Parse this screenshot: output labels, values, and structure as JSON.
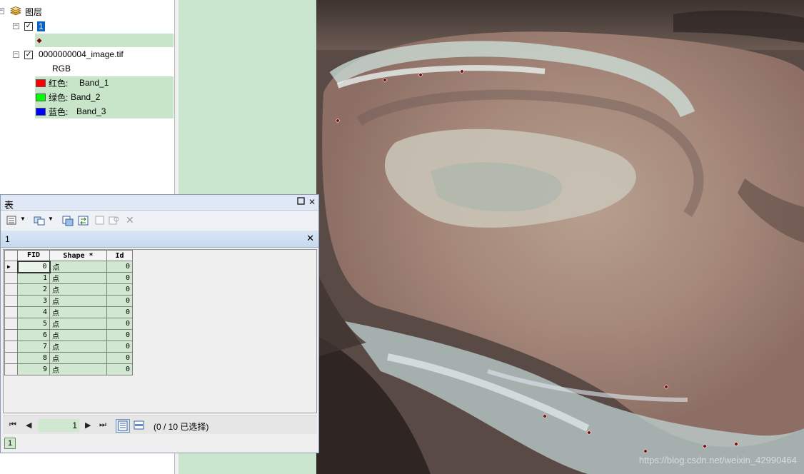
{
  "toc": {
    "root_label": "图层",
    "layer1": {
      "name": "1",
      "checked": true
    },
    "layer2": {
      "name": "0000000004_image.tif",
      "checked": true,
      "renderer": "RGB"
    },
    "bands": [
      {
        "label": "红色:",
        "band": "Band_1",
        "color": "#ff0000"
      },
      {
        "label": "绿色:",
        "band": "Band_2",
        "color": "#00ff00"
      },
      {
        "label": "蓝色:",
        "band": "Band_3",
        "color": "#0000ff"
      }
    ]
  },
  "table_window": {
    "title": "表",
    "tab_name": "1",
    "columns": [
      "FID",
      "Shape *",
      "Id"
    ],
    "rows": [
      {
        "fid": "0",
        "shape": "点",
        "id": "0"
      },
      {
        "fid": "1",
        "shape": "点",
        "id": "0"
      },
      {
        "fid": "2",
        "shape": "点",
        "id": "0"
      },
      {
        "fid": "3",
        "shape": "点",
        "id": "0"
      },
      {
        "fid": "4",
        "shape": "点",
        "id": "0"
      },
      {
        "fid": "5",
        "shape": "点",
        "id": "0"
      },
      {
        "fid": "6",
        "shape": "点",
        "id": "0"
      },
      {
        "fid": "7",
        "shape": "点",
        "id": "0"
      },
      {
        "fid": "8",
        "shape": "点",
        "id": "0"
      },
      {
        "fid": "9",
        "shape": "点",
        "id": "0"
      }
    ],
    "current_record": "1",
    "selection_status": "(0 / 10 已选择)",
    "bottom_tab": "1"
  },
  "map": {
    "watermark": "https://blog.csdn.net/weixin_42990464",
    "point_color": "#7a0a0a"
  },
  "colors": {
    "highlight": "#c9e5c9",
    "selection": "#0a64c8",
    "green_pane": "#cbe6cf"
  }
}
